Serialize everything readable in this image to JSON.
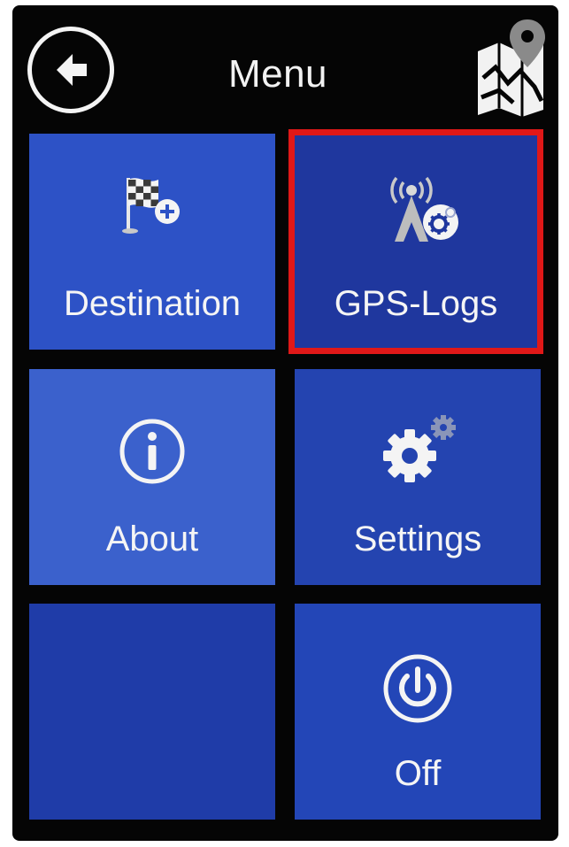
{
  "header": {
    "title": "Menu",
    "back_icon": "arrow-left-icon",
    "map_icon": "map-pin-icon"
  },
  "tiles": [
    {
      "label": "Destination",
      "icon": "checkered-flag-plus-icon"
    },
    {
      "label": "GPS-Logs",
      "icon": "gps-antenna-gear-icon",
      "selected": true
    },
    {
      "label": "About",
      "icon": "info-icon"
    },
    {
      "label": "Settings",
      "icon": "gears-icon"
    },
    {
      "label": "",
      "icon": ""
    },
    {
      "label": "Off",
      "icon": "power-icon"
    }
  ],
  "colors": {
    "background": "#050505",
    "tile": "#2b4fc2",
    "selected_tile": "#1f379e",
    "selection_border": "#e01818",
    "text": "#f5f5f5"
  }
}
